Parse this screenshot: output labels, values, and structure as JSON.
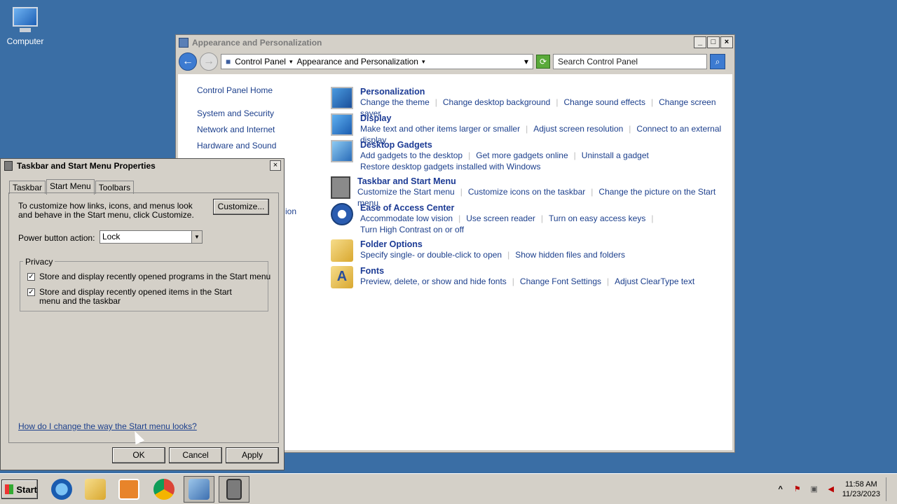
{
  "desktop": {
    "computer_label": "Computer"
  },
  "cp_window": {
    "title": "Appearance and Personalization",
    "breadcrumbs": [
      "Control Panel",
      "Appearance and Personalization"
    ],
    "search_placeholder": "Search Control Panel",
    "left_nav": {
      "home": "Control Panel Home",
      "items": [
        "System and Security",
        "Network and Internet",
        "Hardware and Sound"
      ]
    },
    "partial_text": "ion",
    "categories": [
      {
        "title": "Personalization",
        "links": [
          "Change the theme",
          "Change desktop background",
          "Change sound effects",
          "Change screen saver"
        ]
      },
      {
        "title": "Display",
        "links": [
          "Make text and other items larger or smaller",
          "Adjust screen resolution",
          "Connect to an external display"
        ]
      },
      {
        "title": "Desktop Gadgets",
        "links": [
          "Add gadgets to the desktop",
          "Get more gadgets online",
          "Uninstall a gadget",
          "Restore desktop gadgets installed with Windows"
        ]
      },
      {
        "title": "Taskbar and Start Menu",
        "links": [
          "Customize the Start menu",
          "Customize icons on the taskbar",
          "Change the picture on the Start menu"
        ]
      },
      {
        "title": "Ease of Access Center",
        "links": [
          "Accommodate low vision",
          "Use screen reader",
          "Turn on easy access keys",
          "Turn High Contrast on or off"
        ]
      },
      {
        "title": "Folder Options",
        "links": [
          "Specify single- or double-click to open",
          "Show hidden files and folders"
        ]
      },
      {
        "title": "Fonts",
        "links": [
          "Preview, delete, or show and hide fonts",
          "Change Font Settings",
          "Adjust ClearType text"
        ]
      }
    ]
  },
  "dialog": {
    "title": "Taskbar and Start Menu Properties",
    "tabs": [
      "Taskbar",
      "Start Menu",
      "Toolbars"
    ],
    "intro": "To customize how links, icons, and menus look and behave in the Start menu, click Customize.",
    "customize_label": "Customize...",
    "power_label": "Power button action:",
    "power_value": "Lock",
    "privacy_label": "Privacy",
    "check1": "Store and display recently opened programs in the Start menu",
    "check2": "Store and display recently opened items in the Start menu and the taskbar",
    "help_link": "How do I change the way the Start menu looks?",
    "ok": "OK",
    "cancel": "Cancel",
    "apply": "Apply"
  },
  "taskbar": {
    "start_label": "Start",
    "time": "11:58 AM",
    "date": "11/23/2023",
    "tray_arrow": "^"
  }
}
